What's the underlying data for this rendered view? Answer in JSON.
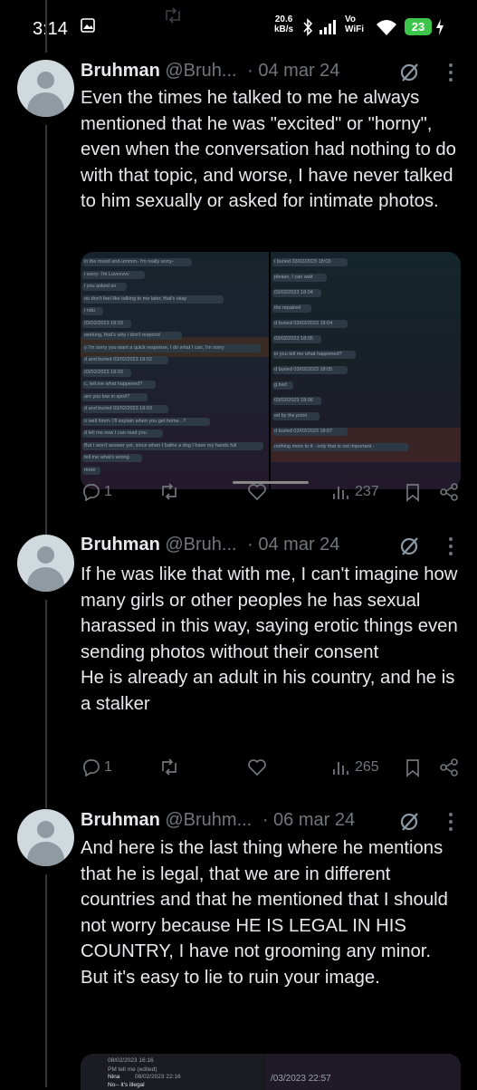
{
  "status_bar": {
    "time": "3:14",
    "net_speed_value": "20.6",
    "net_speed_unit": "kB/s",
    "vo_line1": "Vo",
    "vo_line2": "WiFi",
    "battery": "23"
  },
  "tweets": [
    {
      "name": "Bruhman",
      "handle": "@Bruh...",
      "date": "· 04 mar 24",
      "text": "Even the times he talked to me he always mentioned that he was \"excited\" or \"horny\", even when the conversation had nothing to do with that topic, and worse, I have never talked to him sexually or asked for intimate photos.",
      "replies": "1",
      "views": "237",
      "media_left_lines": [
        "in the mood and-ummm- I'm really sorry-",
        "i sorry- I'm Luvvvvvv",
        "i you asked so",
        "ou don't feel like talking to me later, that's okay",
        "i ndu",
        "03/02/2023 18:03",
        "working, that's why i don't respond",
        "y I'm sorry you want a quick response, I do what I can, I'm sorry",
        "d and buried  03/02/2023 18:02",
        "03/02/2023 18:03",
        "c, tell me what happened?",
        "are you low in spirit?",
        "d and buried  03/02/2023 18:03",
        "o well hmm- I'll explain when you get home...?",
        "d tell me now I can read you",
        "But I won't answer yet, since when I bathe a dog I have my hands full",
        "tell me what's wrong",
        "more"
      ],
      "media_right_lines": [
        "i buried  03/02/2023 18:03",
        "please, I can wait",
        "03/02/2023 18:04",
        "ths repaired",
        "d buried  03/02/2023 18:04",
        "03/02/2023 18:05",
        "in you tell me what happened?",
        "d buried  03/02/2023 18:05",
        "g bad",
        "03/02/2023 18:06",
        "ed by the point",
        "d buried  03/02/2023 18:07",
        "nothing more to it - only that is not important -"
      ]
    },
    {
      "name": "Bruhman",
      "handle": "@Bruh...",
      "date": "· 04 mar 24",
      "text": "If he was like that with me, I can't imagine how many girls or other peoples he has sexual harassed in this way, saying erotic things even sending photos without their consent\nHe is already an adult in his country, and he is a stalker",
      "replies": "1",
      "views": "265"
    },
    {
      "name": "Bruhman",
      "handle": "@Bruhm...",
      "date": "· 06 mar 24",
      "text": "And here is the last thing where he mentions that he is legal, that we are in different countries and that he mentioned that I should not worry because HE IS LEGAL IN HIS COUNTRY, I have not grooming any minor.\nBut it's easy to lie to ruin your image.",
      "media_lines": [
        "08/02/2023 16:16",
        "PM tell me (edited)",
        "Nina",
        "08/02/2023 22:16",
        "No-- it's illegal",
        "/03/2023 22:57"
      ]
    }
  ],
  "colors": {
    "background": "#000000",
    "text": "#e7e9ea",
    "muted": "#71767b",
    "divider": "#333639"
  }
}
